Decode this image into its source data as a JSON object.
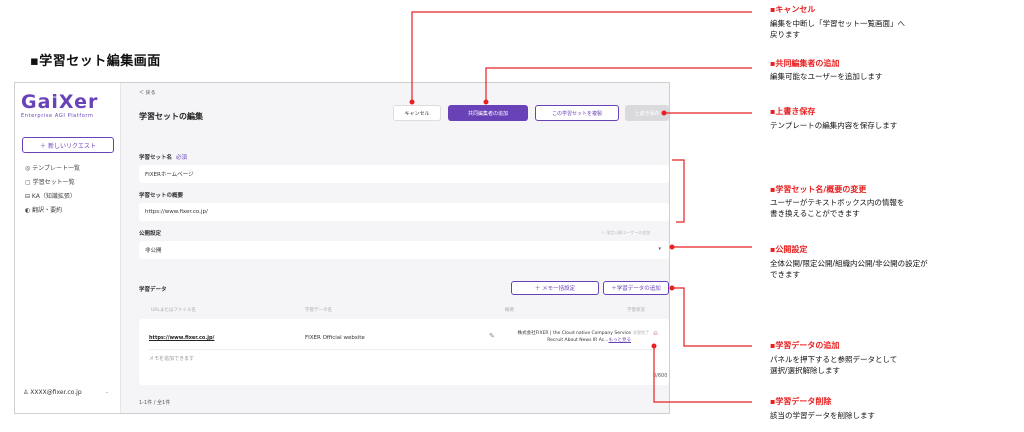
{
  "page_heading": "▪学習セット編集画面",
  "sidebar": {
    "logo": "GaiXer",
    "logo_sub": "Enterprise AGI Platform",
    "new_request": "＋ 新しいリクエスト",
    "items": [
      {
        "label": "◎ テンプレート一覧"
      },
      {
        "label": "▢ 学習セット一覧"
      },
      {
        "label": "⊟ KA（知識拡張）"
      },
      {
        "label": "◐ 翻訳・要約"
      }
    ],
    "user": "♙ XXXX@fixer.co.jp"
  },
  "main": {
    "back": "＜ 戻る",
    "title": "学習セットの編集",
    "buttons": {
      "cancel": "キャンセル",
      "add_collaborator": "共同編集者の追加",
      "copy": "この学習セットを複製",
      "save": "上書き保存"
    },
    "name_label": "学習セット名",
    "required": "必須",
    "name_value": "FIXERホームページ",
    "summary_label": "学習セットの概要",
    "summary_value": "https://www.fixer.co.jp/",
    "visibility_label": "公開設定",
    "visibility_hint": "＋ 限定公開ユーザーの追加",
    "visibility_value": "非公開",
    "data_label": "学習データ",
    "memo_button": "＋ メモ一括設定",
    "add_data_button": "＋学習データの追加",
    "columns": [
      "URLまたはファイル名",
      "学習データ名",
      "概要",
      "学習状況"
    ],
    "row": {
      "url": "https://www.fixer.co.jp/",
      "name": "FIXER Official website",
      "summary": "株式会社FIXER | the Cloud native Company Service Recruit About News IR Ac...",
      "more": "もっと見る",
      "status": "学習完了",
      "memo_placeholder": "メモを追加できます",
      "char_count": "0/600"
    },
    "pager": "1-1件 / 全1件"
  },
  "callouts": [
    {
      "title": "▪キャンセル",
      "desc": [
        "編集を中断し「学習セット一覧画面」へ",
        "戻ります"
      ]
    },
    {
      "title": "▪共同編集者の追加",
      "desc": [
        "編集可能なユーザーを追加します"
      ]
    },
    {
      "title": "▪上書き保存",
      "desc": [
        "テンプレートの編集内容を保存します"
      ]
    },
    {
      "title": "▪学習セット名/概要の変更",
      "desc": [
        "ユーザーがテキストボックス内の情報を",
        "書き換えることができます"
      ]
    },
    {
      "title": "▪公開設定",
      "desc": [
        "全体公開/限定公開/組織内公開/非公開の設定が",
        "できます"
      ]
    },
    {
      "title": "▪学習データの追加",
      "desc": [
        "パネルを押下すると参照データとして",
        "選択/選択解除します"
      ]
    },
    {
      "title": "▪学習データ削除",
      "desc": [
        "該当の学習データを削除します"
      ]
    }
  ],
  "colors": {
    "accent": "#6a42b8",
    "callout": "#e82020"
  }
}
